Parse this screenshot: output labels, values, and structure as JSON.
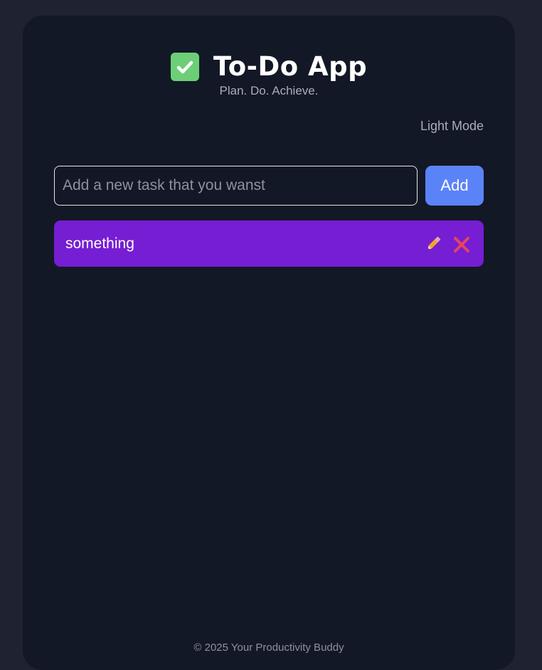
{
  "app": {
    "title": "To-Do App",
    "subtitle": "Plan. Do. Achieve.",
    "theme_toggle_label": "Light Mode"
  },
  "input": {
    "placeholder": "Add a new task that you wanst",
    "value": "",
    "add_label": "Add"
  },
  "tasks": [
    {
      "text": "something",
      "edit_icon": "pencil-icon",
      "delete_icon": "close-icon"
    }
  ],
  "footer": {
    "text": "© 2025 Your Productivity Buddy"
  },
  "colors": {
    "page_bg": "#1f2230",
    "card_bg": "#131826",
    "accent_blue": "#5b83f8",
    "task_purple": "#761ed3",
    "check_green": "#6ccf77",
    "delete_red": "#e5455f"
  }
}
